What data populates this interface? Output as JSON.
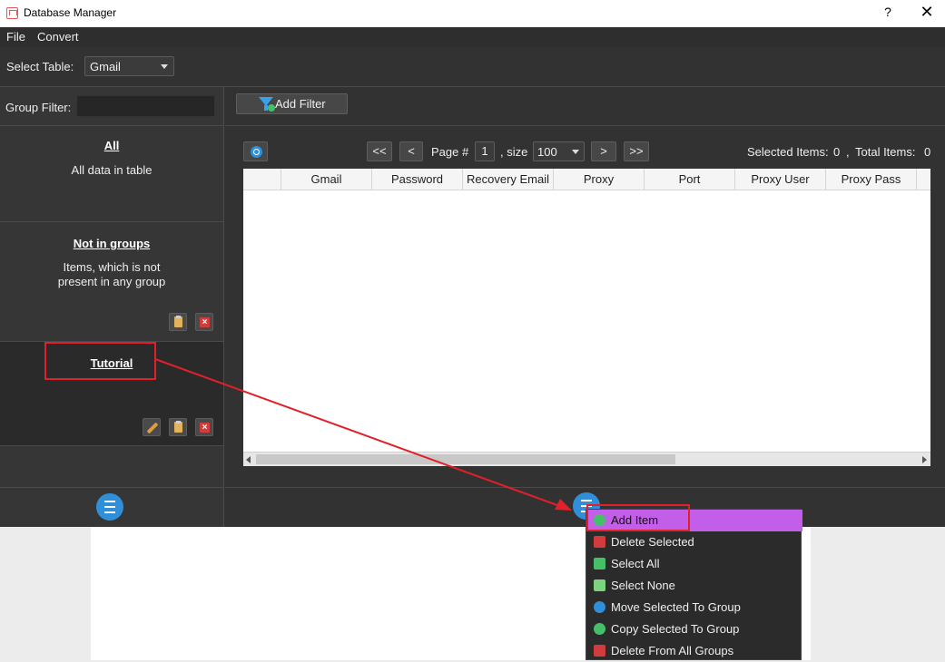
{
  "window": {
    "title": "Database Manager",
    "help": "?",
    "close": "✕"
  },
  "menu": {
    "file": "File",
    "convert": "Convert"
  },
  "toolbar": {
    "select_table_label": "Select Table:",
    "selected_table": "Gmail"
  },
  "left_panel": {
    "group_filter_label": "Group Filter:",
    "group_filter_value": "",
    "groups": [
      {
        "title": "All",
        "description": "All data in table"
      },
      {
        "title": "Not in groups",
        "description_line1": "Items, which is not",
        "description_line2": "present in any group"
      },
      {
        "title": "Tutorial"
      }
    ]
  },
  "filter": {
    "add_filter_label": "Add Filter"
  },
  "pagination": {
    "first": "<<",
    "prev": "<",
    "page_label": "Page #",
    "page": "1",
    "size_label": ", size",
    "size": "100",
    "next": ">",
    "last": ">>",
    "selected_label": "Selected Items:",
    "selected_count": "0",
    "sep": ",",
    "total_label": "Total Items:",
    "total_count": "0"
  },
  "table": {
    "columns": [
      "",
      "Gmail",
      "Password",
      "Recovery Email",
      "Proxy",
      "Port",
      "Proxy User",
      "Proxy Pass"
    ]
  },
  "context_menu": {
    "items": [
      {
        "label": "Add Item",
        "icon": "plus-icon",
        "color": "#46c068"
      },
      {
        "label": "Delete Selected",
        "icon": "delete-icon",
        "color": "#d23c3c"
      },
      {
        "label": "Select All",
        "icon": "check-icon",
        "color": "#46c068"
      },
      {
        "label": "Select None",
        "icon": "square-icon",
        "color": "#7ed47e"
      },
      {
        "label": "Move Selected To Group",
        "icon": "pencil-icon",
        "color": "#2f8fd8"
      },
      {
        "label": "Copy Selected To Group",
        "icon": "plus-icon",
        "color": "#46c068"
      },
      {
        "label": "Delete From All Groups",
        "icon": "delete-icon",
        "color": "#d23c3c"
      }
    ]
  },
  "colors": {
    "accent": "#2f8fd8",
    "highlight": "#c25ee8",
    "annotation": "#e0202a"
  }
}
